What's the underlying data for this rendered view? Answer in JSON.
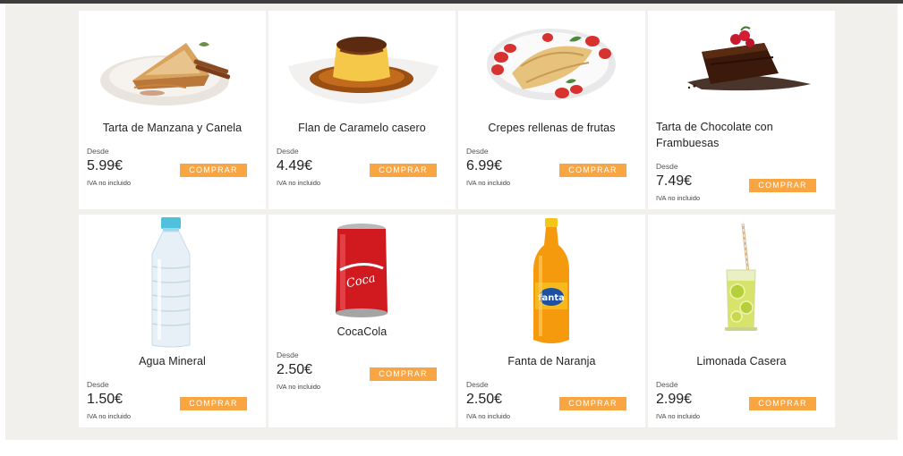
{
  "products": [
    {
      "name": "Tarta de Manzana y Canela",
      "from": "Desde",
      "price": "5.99€",
      "tax": "IVA no incluido",
      "button": "COMPRAR",
      "icon": "apple-tart-icon"
    },
    {
      "name": "Flan de Caramelo casero",
      "from": "Desde",
      "price": "4.49€",
      "tax": "IVA no incluido",
      "button": "COMPRAR",
      "icon": "flan-icon"
    },
    {
      "name": "Crepes rellenas de frutas",
      "from": "Desde",
      "price": "6.99€",
      "tax": "IVA no incluido",
      "button": "COMPRAR",
      "icon": "crepes-icon"
    },
    {
      "name": "Tarta de Chocolate con Frambuesas",
      "from": "Desde",
      "price": "7.49€",
      "tax": "IVA no incluido",
      "button": "COMPRAR",
      "icon": "chocolate-cake-icon"
    },
    {
      "name": "Agua Mineral",
      "from": "Desde",
      "price": "1.50€",
      "tax": "IVA no incluido",
      "button": "COMPRAR",
      "icon": "water-bottle-icon"
    },
    {
      "name": "CocaCola",
      "from": "Desde",
      "price": "2.50€",
      "tax": "IVA no incluido",
      "button": "COMPRAR",
      "icon": "cola-can-icon"
    },
    {
      "name": "Fanta de Naranja",
      "from": "Desde",
      "price": "2.50€",
      "tax": "IVA no incluido",
      "button": "COMPRAR",
      "icon": "orange-soda-icon"
    },
    {
      "name": "Limonada Casera",
      "from": "Desde",
      "price": "2.99€",
      "tax": "IVA no incluido",
      "button": "COMPRAR",
      "icon": "lemonade-icon"
    }
  ],
  "colors": {
    "accent": "#f9a541",
    "panel": "#f1f0ec",
    "card": "#ffffff",
    "topbar": "#3d3d3d"
  }
}
